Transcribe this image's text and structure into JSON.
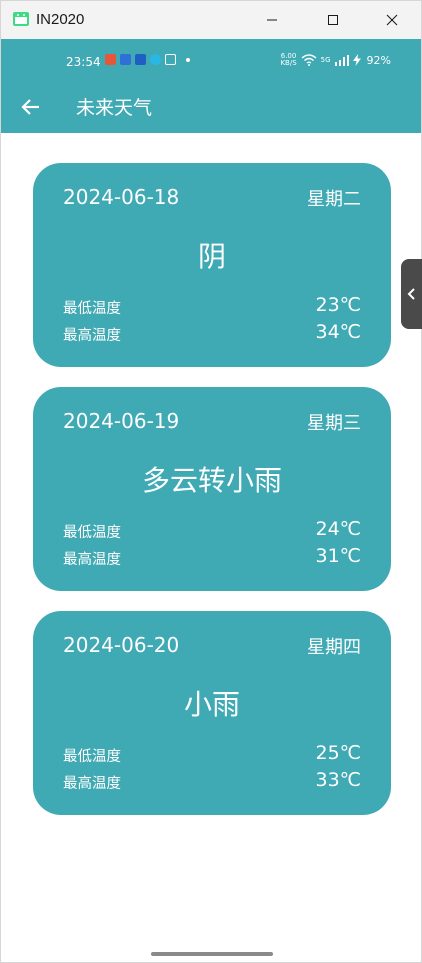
{
  "window": {
    "title": "IN2020"
  },
  "status_bar": {
    "time": "23:54",
    "net_speed_value": "6.00",
    "net_speed_unit": "KB/S",
    "signal_label": "5G",
    "battery": "92%"
  },
  "app_bar": {
    "title": "未来天气"
  },
  "forecasts": [
    {
      "date": "2024-06-18",
      "weekday": "星期二",
      "weather": "阴",
      "low_label": "最低温度",
      "low": "23℃",
      "high_label": "最高温度",
      "high": "34℃"
    },
    {
      "date": "2024-06-19",
      "weekday": "星期三",
      "weather": "多云转小雨",
      "low_label": "最低温度",
      "low": "24℃",
      "high_label": "最高温度",
      "high": "31℃"
    },
    {
      "date": "2024-06-20",
      "weekday": "星期四",
      "weather": "小雨",
      "low_label": "最低温度",
      "low": "25℃",
      "high_label": "最高温度",
      "high": "33℃"
    }
  ],
  "colors": {
    "primary": "#3fa9b4",
    "on_primary": "#ffffff"
  }
}
